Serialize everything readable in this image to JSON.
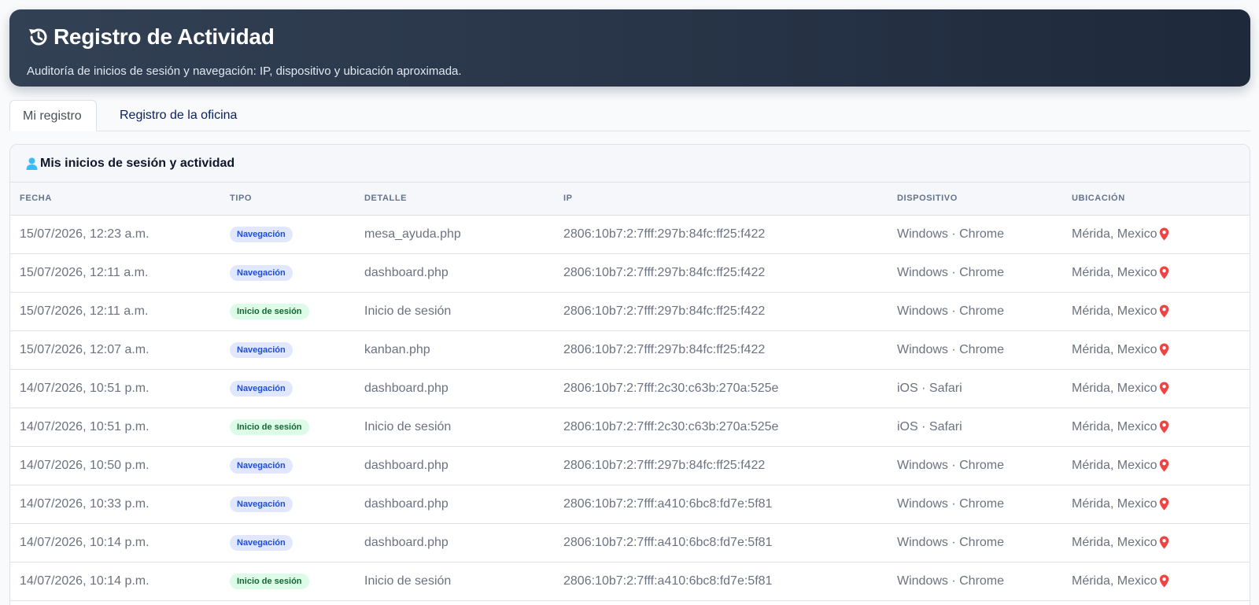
{
  "header": {
    "title": "Registro de Actividad",
    "subtitle": "Auditoría de inicios de sesión y navegación: IP, dispositivo y ubicación aproximada.",
    "icon": "history-icon"
  },
  "tabs": [
    {
      "label": "Mi registro",
      "active": true
    },
    {
      "label": "Registro de la oficina",
      "active": false
    }
  ],
  "card": {
    "title": "Mis inicios de sesión y actividad",
    "icon": "user-icon"
  },
  "table": {
    "columns": [
      "Fecha",
      "Tipo",
      "Detalle",
      "IP",
      "Dispositivo",
      "Ubicación"
    ],
    "rows": [
      {
        "fecha": "15/07/2026, 12:23 a.m.",
        "tipo": "Navegación",
        "kind": "nav",
        "detalle": "mesa_ayuda.php",
        "ip": "2806:10b7:2:7fff:297b:84fc:ff25:f422",
        "dispositivo": "Windows · Chrome",
        "ubicacion": "Mérida, Mexico"
      },
      {
        "fecha": "15/07/2026, 12:11 a.m.",
        "tipo": "Navegación",
        "kind": "nav",
        "detalle": "dashboard.php",
        "ip": "2806:10b7:2:7fff:297b:84fc:ff25:f422",
        "dispositivo": "Windows · Chrome",
        "ubicacion": "Mérida, Mexico"
      },
      {
        "fecha": "15/07/2026, 12:11 a.m.",
        "tipo": "Inicio de sesión",
        "kind": "login",
        "detalle": "Inicio de sesión",
        "ip": "2806:10b7:2:7fff:297b:84fc:ff25:f422",
        "dispositivo": "Windows · Chrome",
        "ubicacion": "Mérida, Mexico"
      },
      {
        "fecha": "15/07/2026, 12:07 a.m.",
        "tipo": "Navegación",
        "kind": "nav",
        "detalle": "kanban.php",
        "ip": "2806:10b7:2:7fff:297b:84fc:ff25:f422",
        "dispositivo": "Windows · Chrome",
        "ubicacion": "Mérida, Mexico"
      },
      {
        "fecha": "14/07/2026, 10:51 p.m.",
        "tipo": "Navegación",
        "kind": "nav",
        "detalle": "dashboard.php",
        "ip": "2806:10b7:2:7fff:2c30:c63b:270a:525e",
        "dispositivo": "iOS · Safari",
        "ubicacion": "Mérida, Mexico"
      },
      {
        "fecha": "14/07/2026, 10:51 p.m.",
        "tipo": "Inicio de sesión",
        "kind": "login",
        "detalle": "Inicio de sesión",
        "ip": "2806:10b7:2:7fff:2c30:c63b:270a:525e",
        "dispositivo": "iOS · Safari",
        "ubicacion": "Mérida, Mexico"
      },
      {
        "fecha": "14/07/2026, 10:50 p.m.",
        "tipo": "Navegación",
        "kind": "nav",
        "detalle": "dashboard.php",
        "ip": "2806:10b7:2:7fff:297b:84fc:ff25:f422",
        "dispositivo": "Windows · Chrome",
        "ubicacion": "Mérida, Mexico"
      },
      {
        "fecha": "14/07/2026, 10:33 p.m.",
        "tipo": "Navegación",
        "kind": "nav",
        "detalle": "dashboard.php",
        "ip": "2806:10b7:2:7fff:a410:6bc8:fd7e:5f81",
        "dispositivo": "Windows · Chrome",
        "ubicacion": "Mérida, Mexico"
      },
      {
        "fecha": "14/07/2026, 10:14 p.m.",
        "tipo": "Navegación",
        "kind": "nav",
        "detalle": "dashboard.php",
        "ip": "2806:10b7:2:7fff:a410:6bc8:fd7e:5f81",
        "dispositivo": "Windows · Chrome",
        "ubicacion": "Mérida, Mexico"
      },
      {
        "fecha": "14/07/2026, 10:14 p.m.",
        "tipo": "Inicio de sesión",
        "kind": "login",
        "detalle": "Inicio de sesión",
        "ip": "2806:10b7:2:7fff:a410:6bc8:fd7e:5f81",
        "dispositivo": "Windows · Chrome",
        "ubicacion": "Mérida, Mexico"
      }
    ]
  },
  "colors": {
    "header_bg": "#1e293b",
    "nav_badge_bg": "#e0e7ff",
    "nav_badge_text": "#1d4ed8",
    "login_badge_bg": "#dcfce7",
    "login_badge_text": "#166534",
    "pin": "#ef4444",
    "user_icon": "#38bdf8"
  }
}
